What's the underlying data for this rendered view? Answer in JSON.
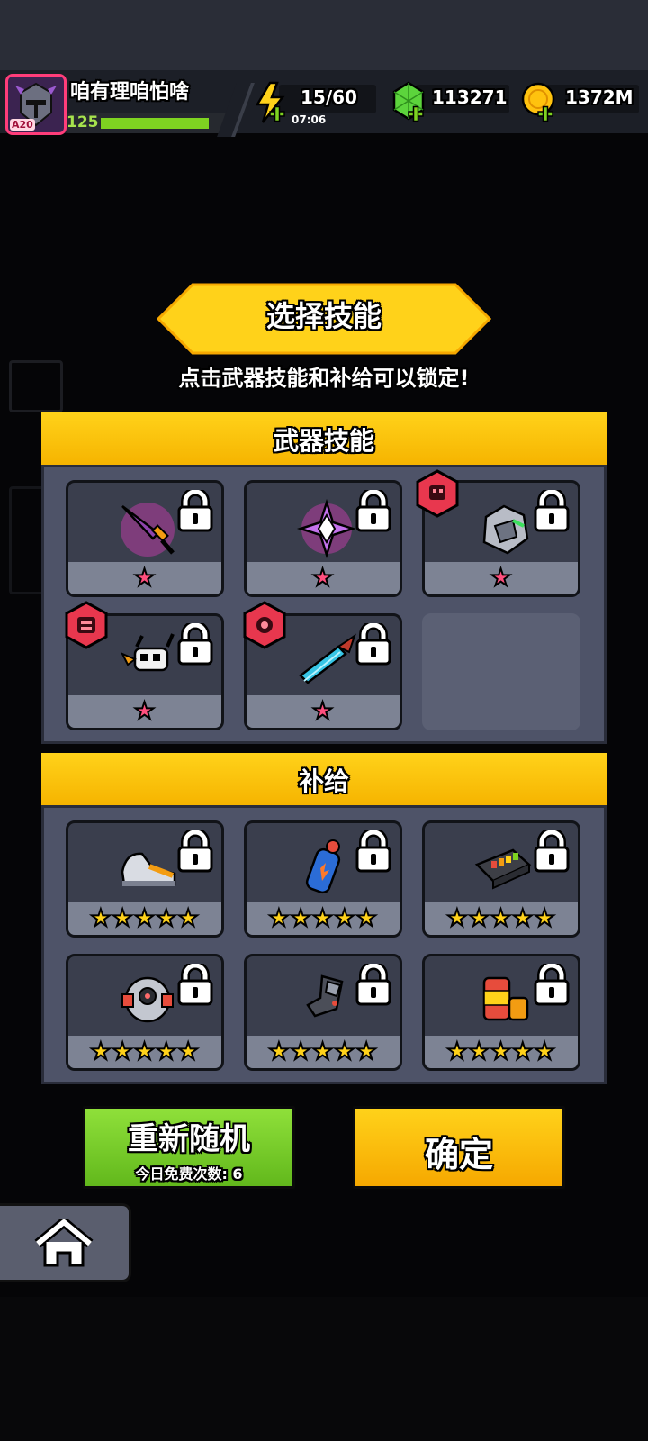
{
  "player": {
    "name": "咱有理咱怕啥",
    "level": "125",
    "avatar_badge": "A20"
  },
  "resources": {
    "energy": {
      "value": "15/60",
      "timer": "07:06"
    },
    "gems": {
      "value": "113271"
    },
    "coins": {
      "value": "1372M"
    }
  },
  "dialog": {
    "title": "选择技能",
    "subtitle": "点击武器技能和补给可以锁定!",
    "weapon_section": {
      "title": "武器技能",
      "items": [
        {
          "icon": "purple-sword-icon",
          "stars": "★",
          "has_badge": false
        },
        {
          "icon": "purple-shuriken-icon",
          "stars": "★",
          "has_badge": false
        },
        {
          "icon": "rock-drone-icon",
          "stars": "★",
          "has_badge": true
        },
        {
          "icon": "robot-drone-icon",
          "stars": "★",
          "has_badge": true
        },
        {
          "icon": "crystal-blade-icon",
          "stars": "★",
          "has_badge": true
        }
      ]
    },
    "supply_section": {
      "title": "补给",
      "items": [
        {
          "icon": "sneaker-icon",
          "stars": "★★★★★"
        },
        {
          "icon": "fuel-canister-icon",
          "stars": "★★★★★"
        },
        {
          "icon": "battery-pack-icon",
          "stars": "★★★★★"
        },
        {
          "icon": "drone-core-icon",
          "stars": "★★★★★"
        },
        {
          "icon": "armor-gauntlet-icon",
          "stars": "★★★★★"
        },
        {
          "icon": "energy-drink-icon",
          "stars": "★★★★★"
        }
      ]
    },
    "reroll_button": {
      "label": "重新随机",
      "sub_label": "今日免费次数: 6"
    },
    "confirm_button": {
      "label": "确定"
    }
  },
  "colors": {
    "accent_yellow": "#ffd21a",
    "green_button": "#7ed321",
    "panel": "#4e5368",
    "star_pink": "#ff4f7e"
  }
}
